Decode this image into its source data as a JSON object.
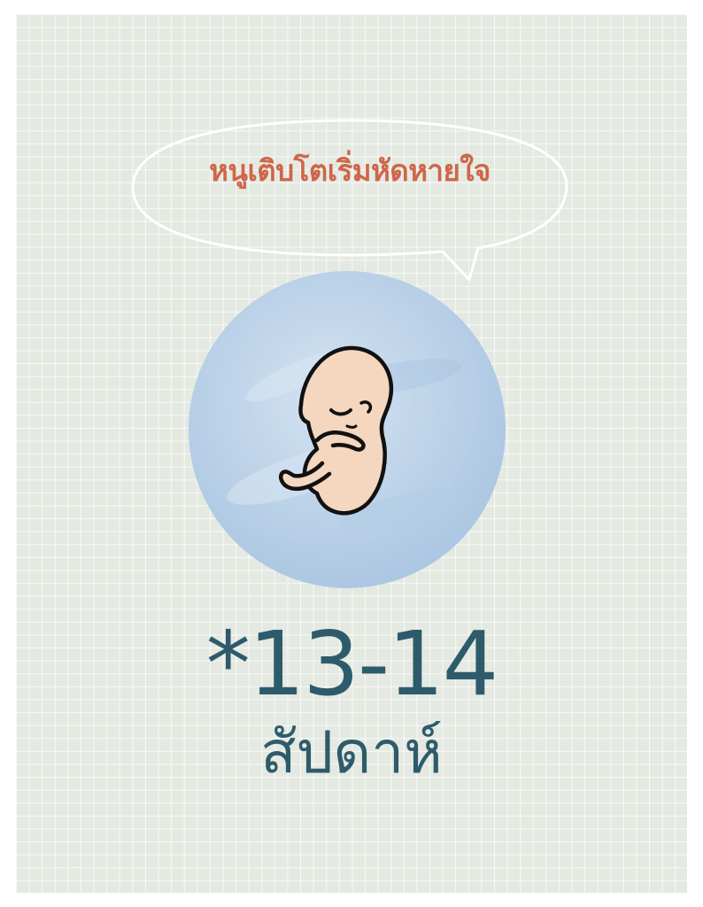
{
  "speech_bubble": {
    "text": "หนูเติบโตเริ่มหัดหายใจ"
  },
  "illustration": {
    "icon": "fetus-icon",
    "circle_color": "#b9d0e6"
  },
  "week": {
    "number": "*13-14",
    "unit": "สัปดาห์"
  },
  "colors": {
    "background_grid": "#e4e9e1",
    "bubble_text": "#cf6649",
    "week_text": "#2e5b6c",
    "fetus_skin": "#f5d6bf"
  }
}
